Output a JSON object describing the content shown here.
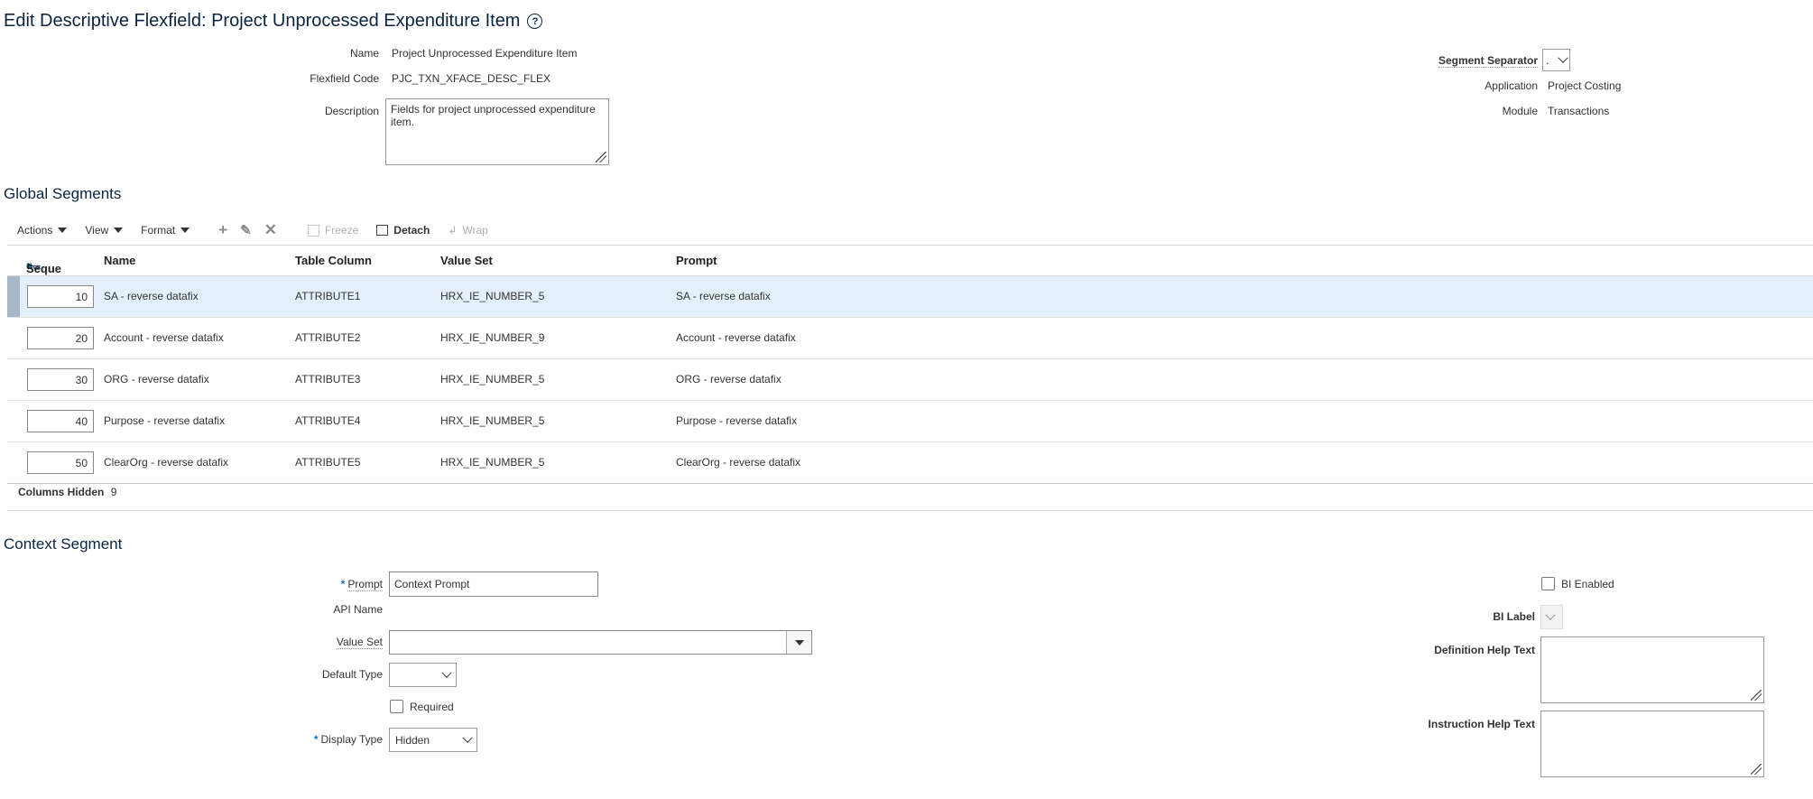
{
  "page": {
    "title": "Edit Descriptive Flexfield: Project Unprocessed Expenditure Item",
    "help_icon": "question-circle-icon"
  },
  "header": {
    "name_label": "Name",
    "name_value": "Project Unprocessed Expenditure Item",
    "code_label": "Flexfield Code",
    "code_value": "PJC_TXN_XFACE_DESC_FLEX",
    "description_label": "Description",
    "description_value": "Fields for project unprocessed expenditure item.",
    "segment_separator_label": "Segment Separator",
    "segment_separator_value": ".",
    "application_label": "Application",
    "application_value": "Project Costing",
    "module_label": "Module",
    "module_value": "Transactions"
  },
  "global_segments": {
    "title": "Global Segments",
    "toolbar": {
      "actions": "Actions",
      "view": "View",
      "format": "Format",
      "freeze": "Freeze",
      "detach": "Detach",
      "wrap": "Wrap"
    },
    "columns": {
      "sequence": "Seque",
      "name": "Name",
      "table_column": "Table Column",
      "value_set": "Value Set",
      "prompt": "Prompt"
    },
    "rows": [
      {
        "sequence": "10",
        "name": "SA - reverse datafix",
        "table_column": "ATTRIBUTE1",
        "value_set": "HRX_IE_NUMBER_5",
        "prompt": "SA - reverse datafix"
      },
      {
        "sequence": "20",
        "name": "Account - reverse datafix",
        "table_column": "ATTRIBUTE2",
        "value_set": "HRX_IE_NUMBER_9",
        "prompt": "Account - reverse datafix"
      },
      {
        "sequence": "30",
        "name": "ORG - reverse datafix",
        "table_column": "ATTRIBUTE3",
        "value_set": "HRX_IE_NUMBER_5",
        "prompt": "ORG - reverse datafix"
      },
      {
        "sequence": "40",
        "name": "Purpose - reverse datafix",
        "table_column": "ATTRIBUTE4",
        "value_set": "HRX_IE_NUMBER_5",
        "prompt": "Purpose - reverse datafix"
      },
      {
        "sequence": "50",
        "name": "ClearOrg - reverse datafix",
        "table_column": "ATTRIBUTE5",
        "value_set": "HRX_IE_NUMBER_5",
        "prompt": "ClearOrg - reverse datafix"
      }
    ],
    "columns_hidden_label": "Columns Hidden",
    "columns_hidden_value": "9"
  },
  "context_segment": {
    "title": "Context Segment",
    "required_marker": "*",
    "prompt_label": "Prompt",
    "prompt_value": "Context Prompt",
    "api_name_label": "API Name",
    "value_set_label": "Value Set",
    "value_set_value": "",
    "default_type_label": "Default Type",
    "default_type_value": "",
    "required_label": "Required",
    "display_type_label": "Display Type",
    "display_type_value": "Hidden",
    "bi_enabled_label": "BI Enabled",
    "bi_label_label": "BI Label",
    "definition_help_label": "Definition Help Text",
    "instruction_help_label": "Instruction Help Text"
  }
}
